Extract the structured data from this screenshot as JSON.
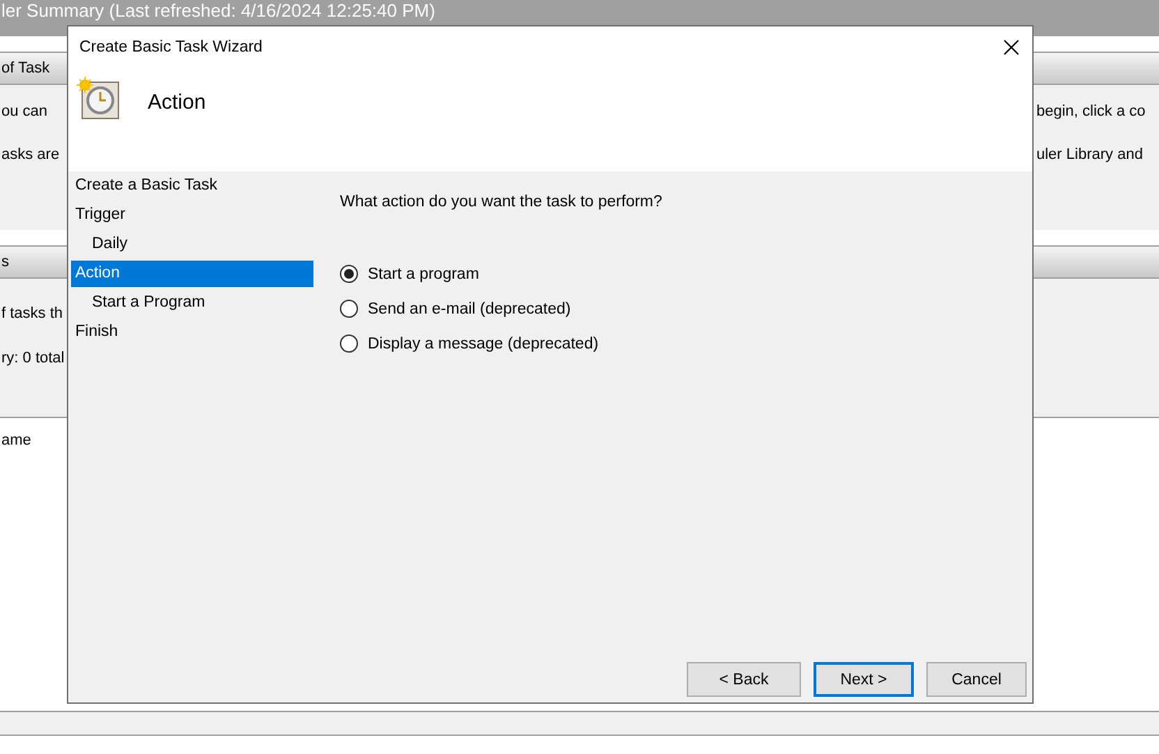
{
  "background_window": {
    "title": "ler Summary (Last refreshed: 4/16/2024 12:25:40 PM)",
    "sections": [
      {
        "header": "of Task",
        "lines": [
          {
            "left": "ou can",
            "right": "begin, click a co"
          },
          {
            "left": "asks are",
            "right": "uler Library and"
          }
        ]
      },
      {
        "header": "s",
        "lines": [
          {
            "left": "f tasks th"
          },
          {
            "left": "ry: 0 total"
          }
        ]
      }
    ],
    "list_column": "ame"
  },
  "dialog": {
    "title": "Create Basic Task Wizard",
    "heading": "Action",
    "steps": [
      {
        "label": "Create a Basic Task",
        "selected": false
      },
      {
        "label": "Trigger",
        "selected": false,
        "children": [
          {
            "label": "Daily",
            "selected": false
          }
        ]
      },
      {
        "label": "Action",
        "selected": true,
        "children": [
          {
            "label": "Start a Program",
            "selected": false
          }
        ]
      },
      {
        "label": "Finish",
        "selected": false
      }
    ],
    "question": "What action do you want the task to perform?",
    "options": [
      {
        "label": "Start a program",
        "selected": true
      },
      {
        "label": "Send an e-mail (deprecated)",
        "selected": false
      },
      {
        "label": "Display a message (deprecated)",
        "selected": false
      }
    ],
    "buttons": [
      {
        "label": "< Back",
        "default": false
      },
      {
        "label": "Next >",
        "default": true
      },
      {
        "label": "Cancel",
        "default": false
      }
    ]
  }
}
